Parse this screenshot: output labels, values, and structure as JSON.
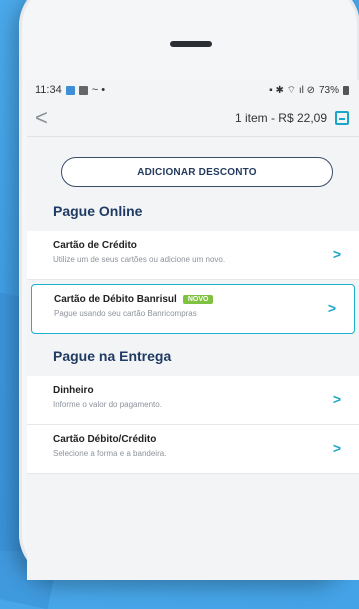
{
  "status": {
    "time": "11:34",
    "dots": "~ •",
    "battery": "73%"
  },
  "header": {
    "back": "<",
    "cart": "1 item - R$ 22,09"
  },
  "discount_button": "ADICIONAR DESCONTO",
  "online": {
    "title": "Pague Online",
    "items": [
      {
        "title": "Cartão de Crédito",
        "subtitle": "Utilize um de seus cartões ou adicione um novo."
      },
      {
        "title": "Cartão de Débito Banrisul",
        "badge": "NOVO",
        "subtitle": "Pague usando seu cartão Banricompras"
      }
    ]
  },
  "delivery": {
    "title": "Pague na Entrega",
    "items": [
      {
        "title": "Dinheiro",
        "subtitle": "Informe o valor do pagamento."
      },
      {
        "title": "Cartão Débito/Crédito",
        "subtitle": "Selecione a forma e a bandeira."
      }
    ]
  },
  "chevron": ">",
  "colors": {
    "accent": "#1aa6c8",
    "heading": "#1f3a63",
    "badge": "#7fc241"
  }
}
